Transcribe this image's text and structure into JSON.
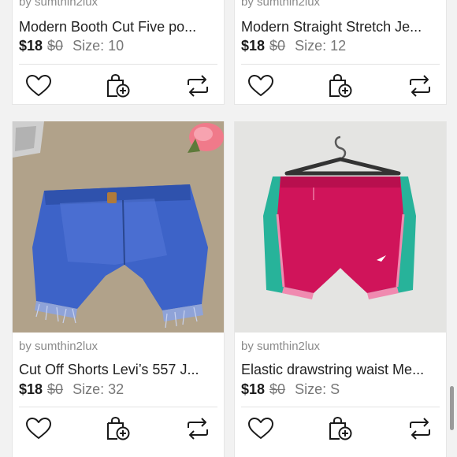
{
  "listings": [
    {
      "seller": "by sumthin2lux",
      "title": "Modern Booth Cut Five po...",
      "price": "$18",
      "original_price": "$0",
      "size": "Size: 10"
    },
    {
      "seller": "by sumthin2lux",
      "title": "Modern Straight Stretch Je...",
      "price": "$18",
      "original_price": "$0",
      "size": "Size: 12"
    },
    {
      "seller": "by sumthin2lux",
      "title": "Cut Off Shorts Levi’s 557 J...",
      "price": "$18",
      "original_price": "$0",
      "size": "Size: 32"
    },
    {
      "seller": "by sumthin2lux",
      "title": "Elastic drawstring waist Me...",
      "price": "$18",
      "original_price": "$0",
      "size": "Size: S"
    }
  ],
  "icons": {
    "like": "heart-icon",
    "bundle": "bundle-add-icon",
    "share": "share-repost-icon"
  },
  "colors": {
    "icon_stroke": "#1a1a1a",
    "divider": "#e3e3e3",
    "muted_text": "#777777"
  }
}
